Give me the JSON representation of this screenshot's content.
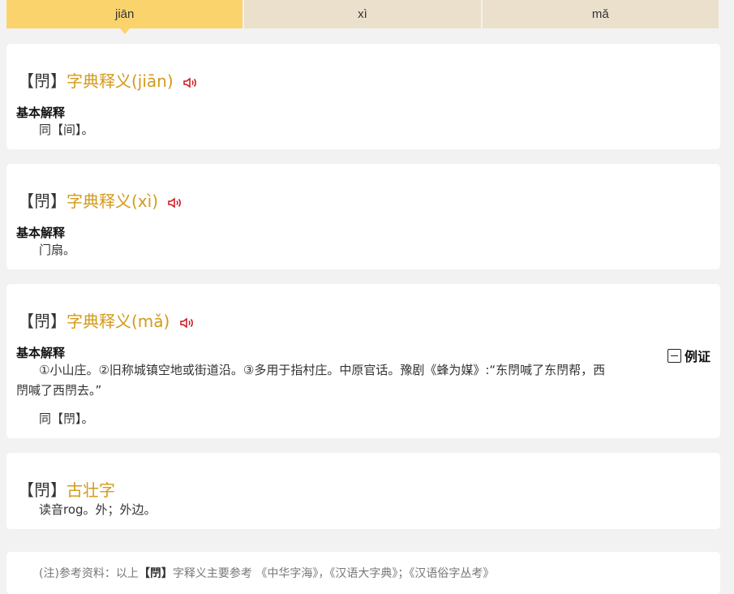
{
  "tabs": [
    {
      "label": "jiān",
      "active": true
    },
    {
      "label": "xì",
      "active": false
    },
    {
      "label": "mǎ",
      "active": false
    }
  ],
  "char": "閅",
  "bracket_open": "【",
  "bracket_close": "】",
  "cards": [
    {
      "title": "字典释义(jiān)",
      "section_label": "基本解释",
      "definition": "同【间】。"
    },
    {
      "title": "字典释义(xì)",
      "section_label": "基本解释",
      "definition": "门扇。"
    },
    {
      "title": "字典释义(mǎ)",
      "section_label": "基本解释",
      "example_label": "例证",
      "definition_line1": "①小山庄。②旧称城镇空地或街道沿。③多用于指村庄。中原官话。豫剧《蜂为媒》:“东閅喊了东閅帮，西",
      "definition_line2": "閅喊了西閅去。”",
      "definition2": "同【閅】。"
    },
    {
      "title": "古壮字",
      "definition": "读音rog。外；外边。"
    }
  ],
  "note": {
    "prefix": "(注)参考资料：以上",
    "char": "【閅】",
    "suffix": "字释义主要参考 《中华字海》，《汉语大字典》；《汉语俗字丛考》"
  },
  "colors": {
    "accent": "#d39a1c",
    "tab_active": "#fbd36d",
    "tab_inactive": "#ebe0cc",
    "speaker": "#d0141c"
  }
}
